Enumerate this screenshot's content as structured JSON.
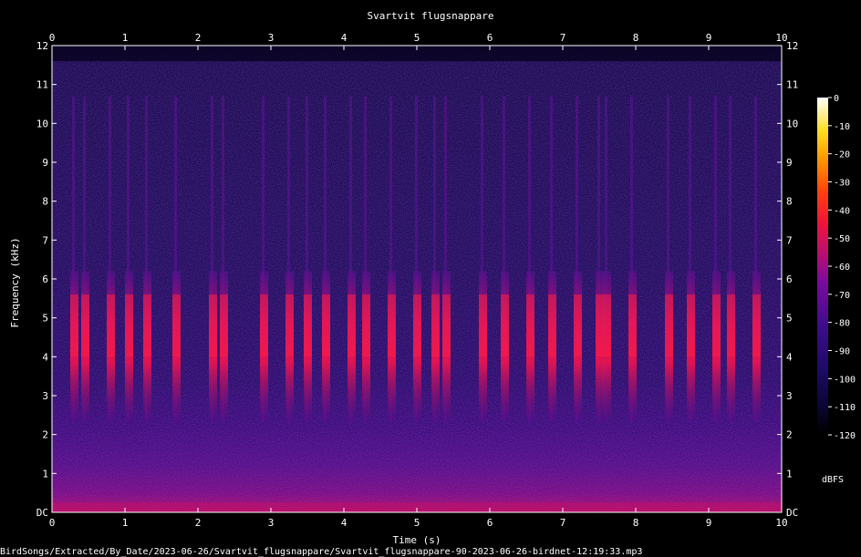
{
  "chart_data": {
    "type": "heatmap",
    "title": "Svartvit flugsnappare",
    "xlabel": "Time (s)",
    "ylabel": "Frequency (kHz)",
    "xlim": [
      0,
      10
    ],
    "ylim": [
      0,
      12
    ],
    "x_ticks": [
      "0",
      "1",
      "2",
      "3",
      "4",
      "5",
      "6",
      "7",
      "8",
      "9",
      "10"
    ],
    "y_ticks": [
      "DC",
      "1",
      "2",
      "3",
      "4",
      "5",
      "6",
      "7",
      "8",
      "9",
      "10",
      "11",
      "12"
    ],
    "colorbar": {
      "label": "dBFS",
      "range": [
        -120,
        0
      ],
      "ticks": [
        "0",
        "-10",
        "-20",
        "-30",
        "-40",
        "-50",
        "-60",
        "-70",
        "-80",
        "-90",
        "-100",
        "-110",
        "-120"
      ]
    },
    "footer": "BirdSongs/Extracted/By_Date/2023-06-26/Svartvit_flugsnappare/Svartvit_flugsnappare-90-2023-06-26-birdnet-12:19:33.mp3",
    "calls_s": [
      0.3,
      0.45,
      0.8,
      1.05,
      1.3,
      1.7,
      2.2,
      2.35,
      2.9,
      3.25,
      3.5,
      3.75,
      4.1,
      4.3,
      4.65,
      5.0,
      5.25,
      5.4,
      5.9,
      6.2,
      6.55,
      6.85,
      7.2,
      7.5,
      7.6,
      7.95,
      8.45,
      8.75,
      9.1,
      9.3,
      9.65
    ],
    "call_freq_khz": [
      2.3,
      6.2
    ],
    "call_peak_khz": [
      4.0,
      5.6
    ]
  }
}
